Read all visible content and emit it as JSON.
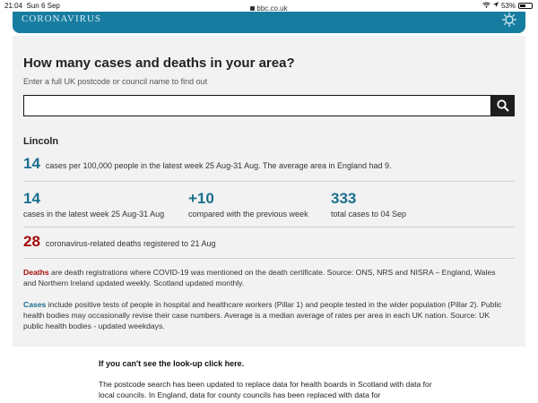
{
  "status_bar": {
    "time": "21:04",
    "date": "Sun 6 Sep",
    "url": "bbc.co.uk",
    "battery": "53%",
    "battery_level": 0.53
  },
  "banner": {
    "title": "CORONAVIRUS"
  },
  "lookup": {
    "heading": "How many cases and deaths in your area?",
    "subheading": "Enter a full UK postcode or council name to find out",
    "search_value": "",
    "search_placeholder": ""
  },
  "result": {
    "place": "Lincoln",
    "rate": {
      "value": "14",
      "text": "cases per 100,000 people in the latest week 25 Aug-31 Aug. The average area in England had 9."
    },
    "stats": [
      {
        "value": "14",
        "label": "cases in the latest week 25 Aug-31 Aug"
      },
      {
        "value": "+10",
        "label": "compared with the previous week"
      },
      {
        "value": "333",
        "label": "total cases to 04 Sep"
      }
    ],
    "deaths": {
      "value": "28",
      "text": "coronavirus-related deaths registered to 21 Aug"
    }
  },
  "notes": {
    "deaths_key": "Deaths",
    "deaths_text": "are death registrations where COVID-19 was mentioned on the death certificate. Source: ONS, NRS and NISRA – England, Wales and Northern Ireland updated weekly. Scotland updated monthly.",
    "cases_key": "Cases",
    "cases_text": "include positive tests of people in hospital and healthcare workers (Pillar 1) and people tested in the wider population (Pillar 2). Public health bodies may occasionally revise their case numbers. Average is a median average of rates per area in each UK nation. Source: UK public health bodies - updated weekdays."
  },
  "footer": {
    "link": "If you can't see the look-up click here.",
    "paragraph": "The postcode search has been updated to replace data for health boards in Scotland with data for local councils. In England, data for county councils has been replaced with data for"
  },
  "colors": {
    "banner": "#177da0",
    "stat_blue": "#1b6f8e",
    "death_red": "#a50b0b",
    "card_bg": "#f2f2f2"
  }
}
